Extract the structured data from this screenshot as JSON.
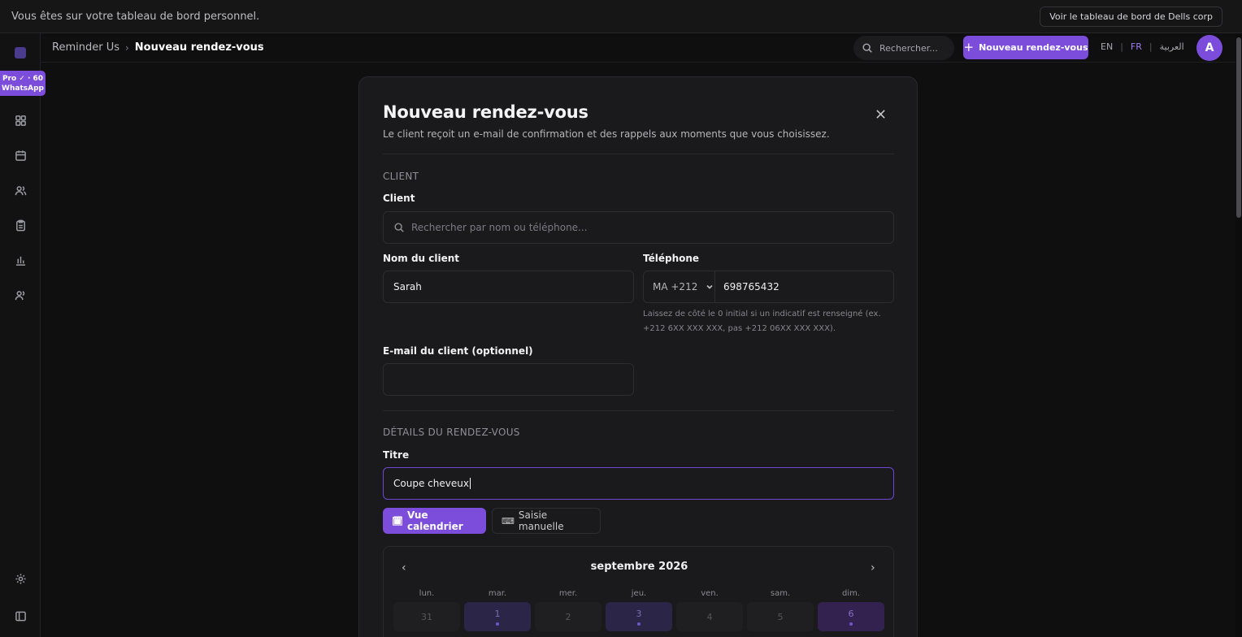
{
  "topbar": {
    "message": "Vous êtes sur votre tableau de bord personnel.",
    "view_button": "Voir le tableau de bord de Dells corp"
  },
  "sidebar": {
    "pro_badge_line1": "Pro ✓ · 60",
    "pro_badge_line2": "WhatsApp"
  },
  "header": {
    "breadcrumb_root": "Reminder Us",
    "breadcrumb_separator": "›",
    "breadcrumb_current": "Nouveau rendez-vous",
    "search_placeholder": "Rechercher...",
    "new_button": "Nouveau rendez-vous",
    "languages": [
      "EN",
      "FR",
      "العربية"
    ],
    "active_language": "FR",
    "avatar_initial": "A"
  },
  "modal": {
    "title": "Nouveau rendez-vous",
    "subtitle": "Le client reçoit un e-mail de confirmation et des rappels aux moments que vous choisissez.",
    "section_client": "CLIENT",
    "client_label": "Client",
    "client_search_placeholder": "Rechercher par nom ou téléphone...",
    "name_label": "Nom du client",
    "name_value": "Sarah",
    "phone_label": "Téléphone",
    "phone_prefix": "MA +212",
    "phone_value": "698765432",
    "phone_hint": "Laissez de côté le 0 initial si un indicatif est renseigné (ex. +212 6XX XXX XXX, pas +212 06XX XXX XXX).",
    "email_label": "E-mail du client (optionnel)",
    "email_value": "",
    "section_details": "DÉTAILS DU RENDEZ-VOUS",
    "title_label": "Titre",
    "title_value": "Coupe cheveux",
    "tab_calendar": "Vue calendrier",
    "tab_manual": "Saisie manuelle",
    "calendar": {
      "month": "septembre 2026",
      "prev": "‹",
      "next": "›",
      "weekdays": [
        "lun.",
        "mar.",
        "mer.",
        "jeu.",
        "ven.",
        "sam.",
        "dim."
      ],
      "days": [
        "31",
        "1",
        "2",
        "3",
        "4",
        "5",
        "6"
      ]
    }
  },
  "colors": {
    "accent": "#7c4ddb",
    "background": "#0f0f10",
    "modal": "#1a1a1c"
  }
}
